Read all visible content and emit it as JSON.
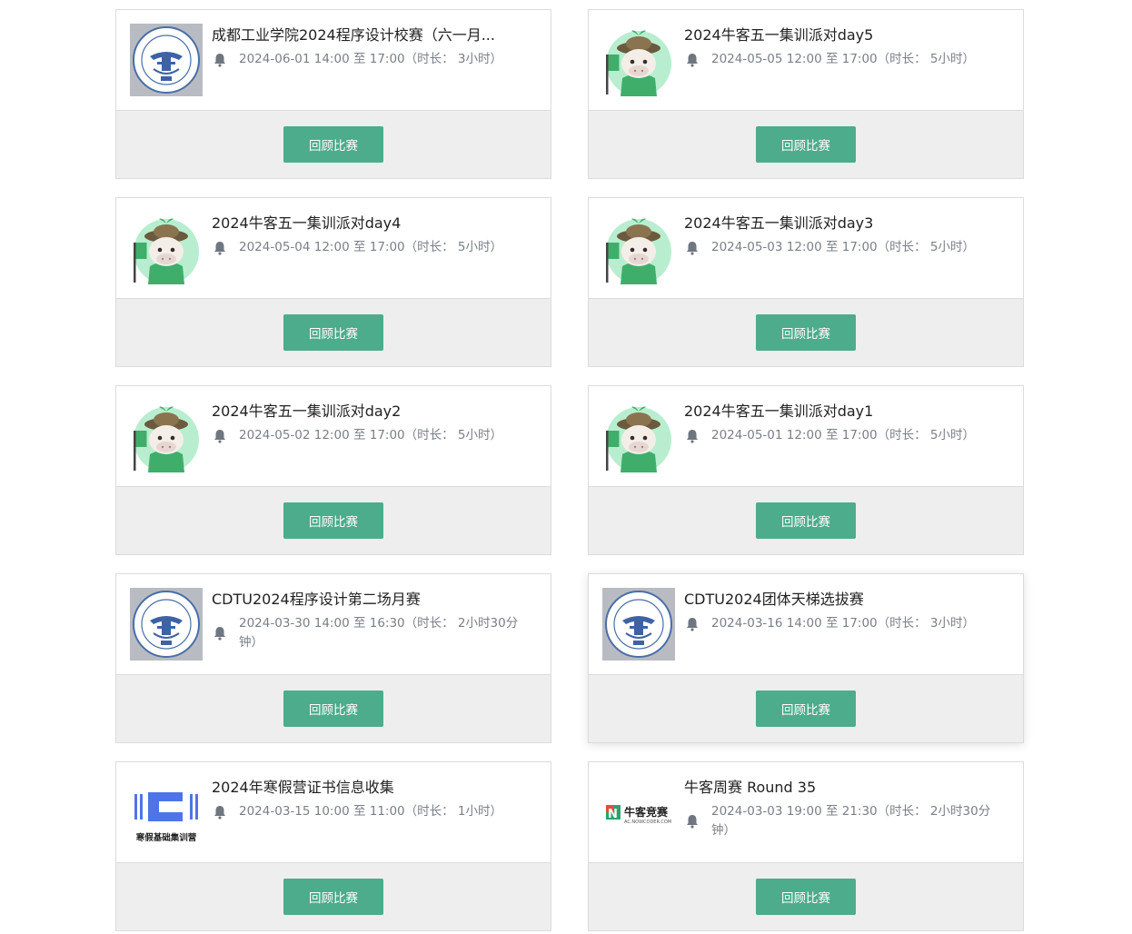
{
  "contests": [
    {
      "logo": "cdtu-seal-logo",
      "title": "成都工业学院2024程序设计校赛（六一月...",
      "time": "2024-06-01 14:00 至 17:00（时长： 3小时）",
      "button": "回顾比赛"
    },
    {
      "logo": "nowcoder-mascot-logo",
      "title": "2024牛客五一集训派对day5",
      "time": "2024-05-05 12:00 至 17:00（时长： 5小时）",
      "button": "回顾比赛"
    },
    {
      "logo": "nowcoder-mascot-logo",
      "title": "2024牛客五一集训派对day4",
      "time": "2024-05-04 12:00 至 17:00（时长： 5小时）",
      "button": "回顾比赛"
    },
    {
      "logo": "nowcoder-mascot-logo",
      "title": "2024牛客五一集训派对day3",
      "time": "2024-05-03 12:00 至 17:00（时长： 5小时）",
      "button": "回顾比赛"
    },
    {
      "logo": "nowcoder-mascot-logo",
      "title": "2024牛客五一集训派对day2",
      "time": "2024-05-02 12:00 至 17:00（时长： 5小时）",
      "button": "回顾比赛"
    },
    {
      "logo": "nowcoder-mascot-logo",
      "title": "2024牛客五一集训派对day1",
      "time": "2024-05-01 12:00 至 17:00（时长： 5小时）",
      "button": "回顾比赛"
    },
    {
      "logo": "cdtu-seal-logo",
      "title": "CDTU2024程序设计第二场月赛",
      "time": "2024-03-30 14:00 至 16:30（时长： 2小时30分钟）",
      "button": "回顾比赛"
    },
    {
      "logo": "cdtu-seal-logo",
      "title": "CDTU2024团体天梯选拔赛",
      "time": "2024-03-16 14:00 至 17:00（时长： 3小时）",
      "button": "回顾比赛"
    },
    {
      "logo": "winter-camp-logo",
      "logo_text": "寒假基础集训营",
      "title": "2024年寒假营证书信息收集",
      "time": "2024-03-15 10:00 至 11:00（时长： 1小时）",
      "button": "回顾比赛"
    },
    {
      "logo": "nowcoder-contest-logo",
      "logo_text": "牛客竞赛",
      "logo_subtext": "AC.NOWCODER.COM",
      "title": "牛客周赛 Round 35",
      "time": "2024-03-03 19:00 至 21:30（时长： 2小时30分钟）",
      "button": "回顾比赛"
    }
  ],
  "colors": {
    "button_bg": "#4cac8c",
    "footer_bg": "#eeeeee",
    "border": "#dcdcdc",
    "time_text": "#7a7f87"
  }
}
